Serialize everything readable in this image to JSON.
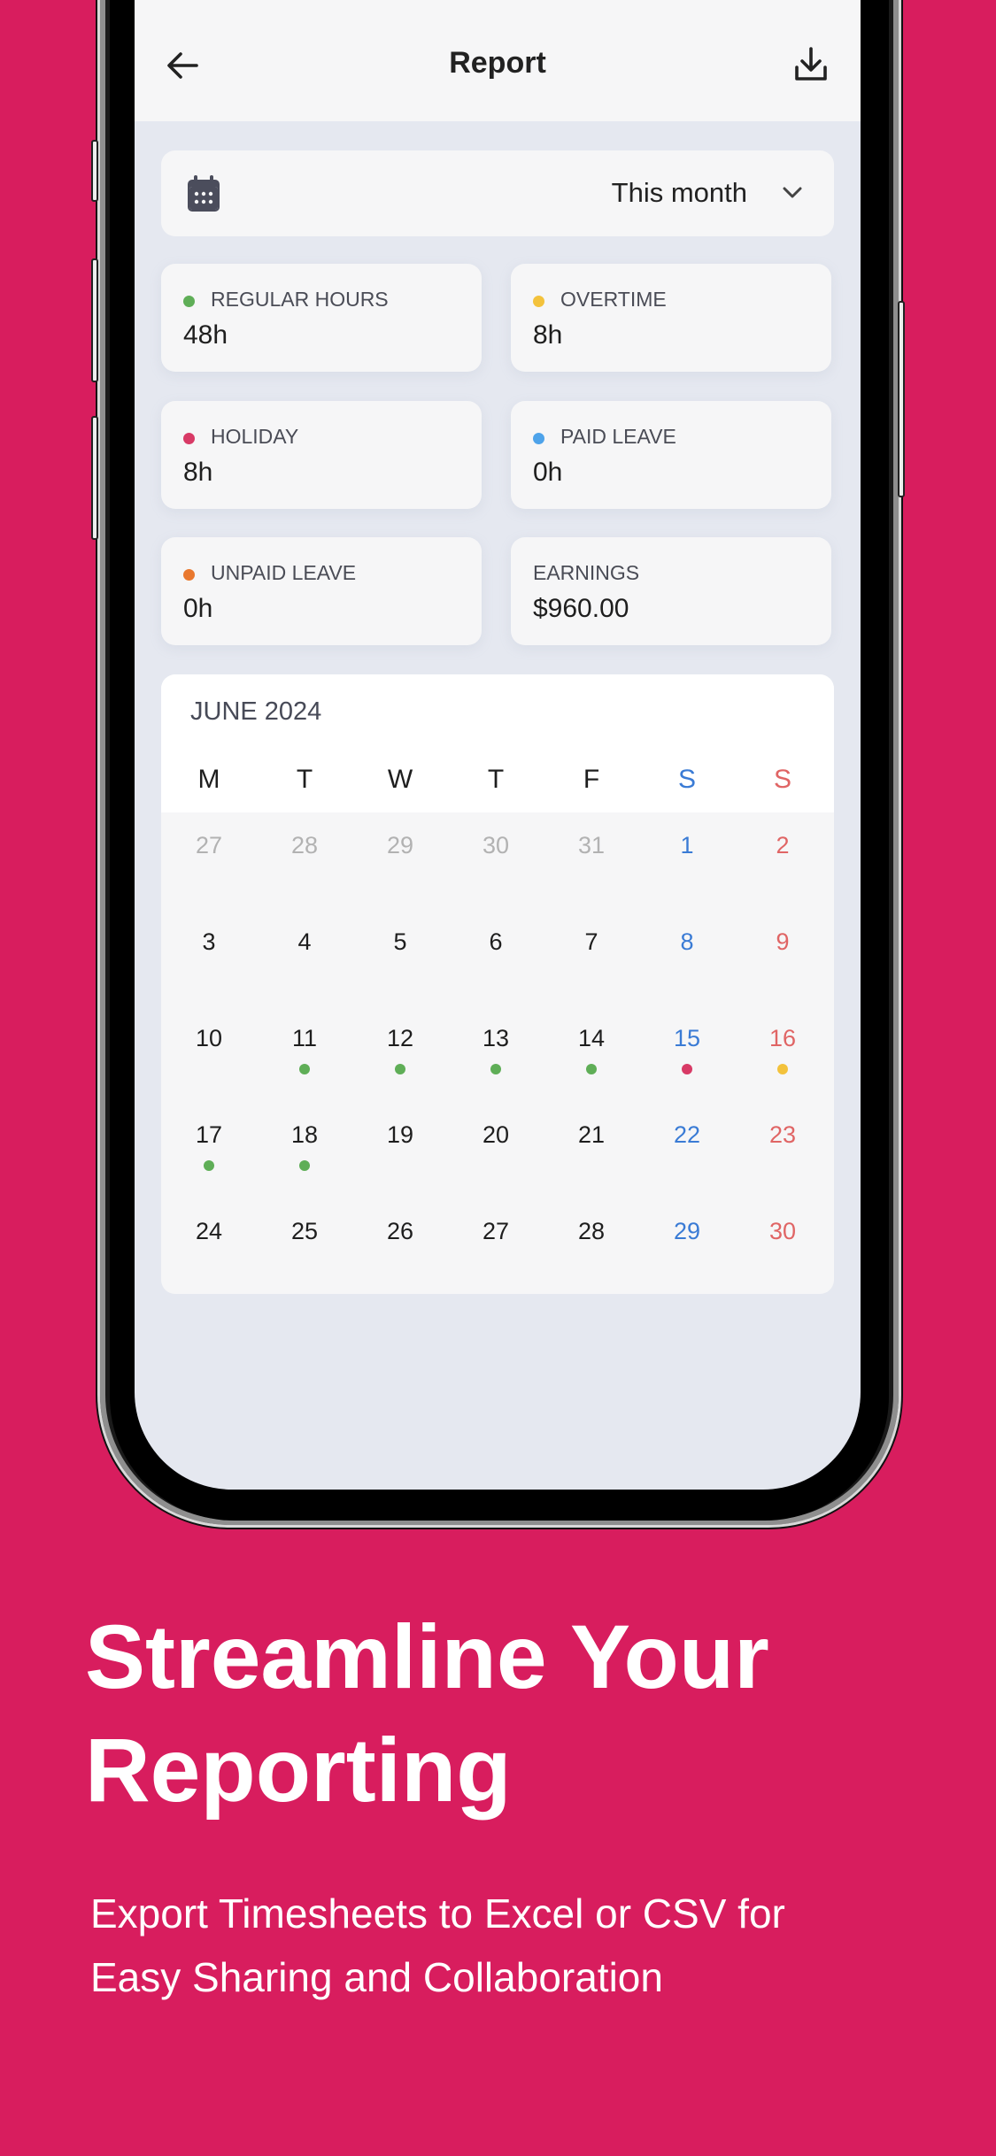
{
  "header": {
    "title": "Report",
    "back_icon": "arrow-left-icon",
    "download_icon": "download-icon"
  },
  "range_selector": {
    "icon": "calendar-icon",
    "value": "This month",
    "chevron_icon": "chevron-down-icon"
  },
  "stats": [
    {
      "label": "REGULAR HOURS",
      "value": "48h",
      "dot_color": "#5FAE57"
    },
    {
      "label": "OVERTIME",
      "value": "8h",
      "dot_color": "#F3C23C"
    },
    {
      "label": "HOLIDAY",
      "value": "8h",
      "dot_color": "#D83A66"
    },
    {
      "label": "PAID LEAVE",
      "value": "0h",
      "dot_color": "#4EA3EA"
    },
    {
      "label": "UNPAID LEAVE",
      "value": "0h",
      "dot_color": "#E9782E"
    },
    {
      "label": "EARNINGS",
      "value": "$960.00",
      "dot_color": null
    }
  ],
  "calendar": {
    "month_label": "JUNE 2024",
    "weekdays": [
      "M",
      "T",
      "W",
      "T",
      "F",
      "S",
      "S"
    ],
    "weeks": [
      [
        {
          "d": "27",
          "out": true
        },
        {
          "d": "28",
          "out": true
        },
        {
          "d": "29",
          "out": true
        },
        {
          "d": "30",
          "out": true
        },
        {
          "d": "31",
          "out": true
        },
        {
          "d": "1"
        },
        {
          "d": "2"
        }
      ],
      [
        {
          "d": "3"
        },
        {
          "d": "4"
        },
        {
          "d": "5"
        },
        {
          "d": "6"
        },
        {
          "d": "7"
        },
        {
          "d": "8"
        },
        {
          "d": "9"
        }
      ],
      [
        {
          "d": "10"
        },
        {
          "d": "11",
          "mark": "regular"
        },
        {
          "d": "12",
          "mark": "regular"
        },
        {
          "d": "13",
          "mark": "regular"
        },
        {
          "d": "14",
          "mark": "regular"
        },
        {
          "d": "15",
          "mark": "holiday"
        },
        {
          "d": "16",
          "mark": "overtime"
        }
      ],
      [
        {
          "d": "17",
          "mark": "regular"
        },
        {
          "d": "18",
          "mark": "regular"
        },
        {
          "d": "19"
        },
        {
          "d": "20"
        },
        {
          "d": "21"
        },
        {
          "d": "22"
        },
        {
          "d": "23"
        }
      ],
      [
        {
          "d": "24"
        },
        {
          "d": "25"
        },
        {
          "d": "26"
        },
        {
          "d": "27"
        },
        {
          "d": "28"
        },
        {
          "d": "29"
        },
        {
          "d": "30"
        }
      ]
    ],
    "mark_colors": {
      "regular": "#5FAE57",
      "overtime": "#F3C23C",
      "holiday": "#D83A66"
    },
    "saturday_color": "#3A7BD5",
    "sunday_color": "#E06565"
  },
  "marketing": {
    "headline_line1": "Streamline Your",
    "headline_line2": "Reporting",
    "subline_line1": "Export Timesheets to Excel or CSV for",
    "subline_line2": "Easy Sharing and Collaboration"
  },
  "colors": {
    "background": "#D81D5E",
    "screen_bg": "#E5E8F0",
    "card_bg": "#F6F6F7"
  }
}
